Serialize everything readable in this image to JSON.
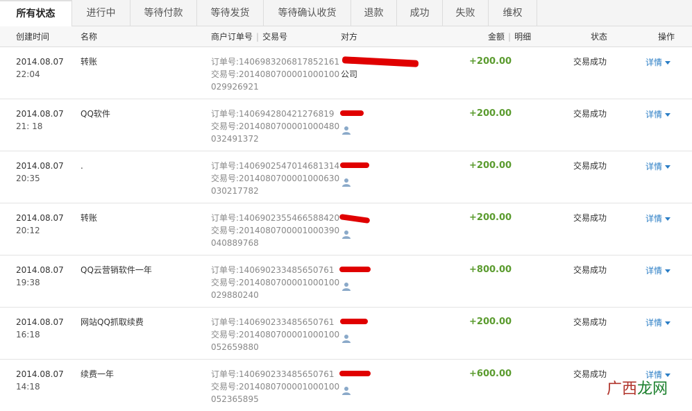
{
  "tabs": [
    {
      "label": "所有状态",
      "active": true
    },
    {
      "label": "进行中"
    },
    {
      "label": "等待付款"
    },
    {
      "label": "等待发货"
    },
    {
      "label": "等待确认收货"
    },
    {
      "label": "退款"
    },
    {
      "label": "成功"
    },
    {
      "label": "失败"
    },
    {
      "label": "维权"
    }
  ],
  "columns": {
    "created": "创建时间",
    "name": "名称",
    "merchant_order": "商户订单号",
    "trade_no": "交易号",
    "party": "对方",
    "amount": "金额",
    "detail": "明细",
    "status": "状态",
    "action": "操作"
  },
  "rows": [
    {
      "date": "2014.08.07",
      "time": "22:04",
      "name": "转账",
      "order": "订单号:140698320681785216​1",
      "trade1": "交易号:2014080700001000100",
      "trade2": "029926921",
      "party": "",
      "party2": "公司",
      "amount": "+200.00",
      "status": "交易成功",
      "detail": "详情"
    },
    {
      "date": "2014.08.07",
      "time": "21: 18",
      "name": "QQ软件",
      "order": "订单号:140694280421276819",
      "trade1": "交易号:2014080700001000480",
      "trade2": "032491372",
      "party": "",
      "party2": "",
      "amount": "+200.00",
      "status": "交易成功",
      "detail": "详情"
    },
    {
      "date": "2014.08.07",
      "time": "20:35",
      "name": ".",
      "order": "订单号:1406902547014681314",
      "trade1": "交易号:2014080700001000630",
      "trade2": "030217782",
      "party": "",
      "party2": "",
      "amount": "+200.00",
      "status": "交易成功",
      "detail": "详情"
    },
    {
      "date": "2014.08.07",
      "time": "20:12",
      "name": "转账",
      "order": "订单号:1406902355466588420",
      "trade1": "交易号:2014080700001000390",
      "trade2": "040889768",
      "party": "",
      "party2": "",
      "amount": "+200.00",
      "status": "交易成功",
      "detail": "详情"
    },
    {
      "date": "2014.08.07",
      "time": "19:38",
      "name": "QQ云营销软件一年",
      "order": "订单号:140690233485650761",
      "trade1": "交易号:2014080700001000100",
      "trade2": "029880240",
      "party": "",
      "party2": "",
      "amount": "+800.00",
      "status": "交易成功",
      "detail": "详情"
    },
    {
      "date": "2014.08.07",
      "time": "16:18",
      "name": "网站QQ抓取续费",
      "order": "订单号:140690233485650761",
      "trade1": "交易号:2014080700001000100",
      "trade2": "052659880",
      "party": "",
      "party2": "",
      "amount": "+200.00",
      "status": "交易成功",
      "detail": "详情"
    },
    {
      "date": "2014.08.07",
      "time": "14:18",
      "name": "续费一年",
      "order": "订单号:140690233485650761",
      "trade1": "交易号:2014080700001000100",
      "trade2": "052365895",
      "party": "",
      "party2": "",
      "amount": "+600.00",
      "status": "交易成功",
      "detail": "详情"
    }
  ],
  "watermark": {
    "part1": "广西",
    "part2": "龙网"
  },
  "colors": {
    "amount": "#5a9b2e",
    "link": "#2a7dc5",
    "redaction": "#e00000"
  }
}
